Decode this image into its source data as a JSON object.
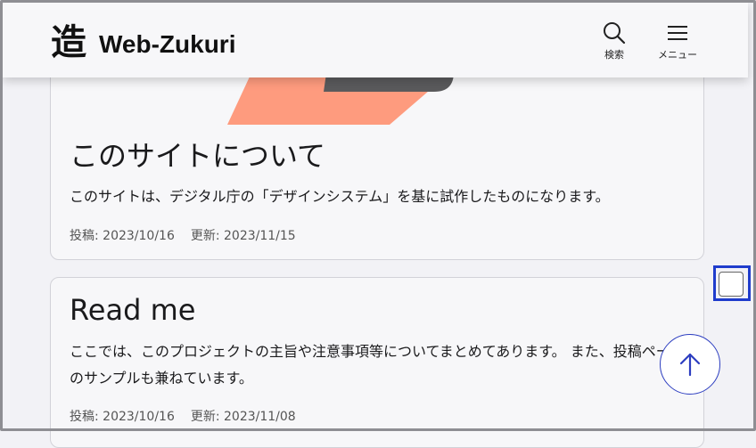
{
  "header": {
    "logo_mark": "造",
    "site_title": "Web-Zukuri",
    "search_label": "検索",
    "menu_label": "メニュー"
  },
  "posts": [
    {
      "title": "このサイトについて",
      "description": "このサイトは、デジタル庁の「デザインシステム」を基に試作したものになります。",
      "posted": "投稿: 2023/10/16",
      "updated": "更新: 2023/11/15"
    },
    {
      "title": "Read me",
      "description": "ここでは、このプロジェクトの主旨や注意事項等についてまとめてあります。 また、投稿ページのサンプルも兼ねています。",
      "posted": "投稿: 2023/10/16",
      "updated": "更新: 2023/11/08"
    }
  ],
  "colors": {
    "accent": "#2d3ec0",
    "thumb_salmon": "#fe9b7e",
    "thumb_dark": "#5a5a5c",
    "focus_ring": "#1f3ccc"
  },
  "icons": [
    "search-icon",
    "hamburger-menu-icon",
    "arrow-up-icon"
  ]
}
